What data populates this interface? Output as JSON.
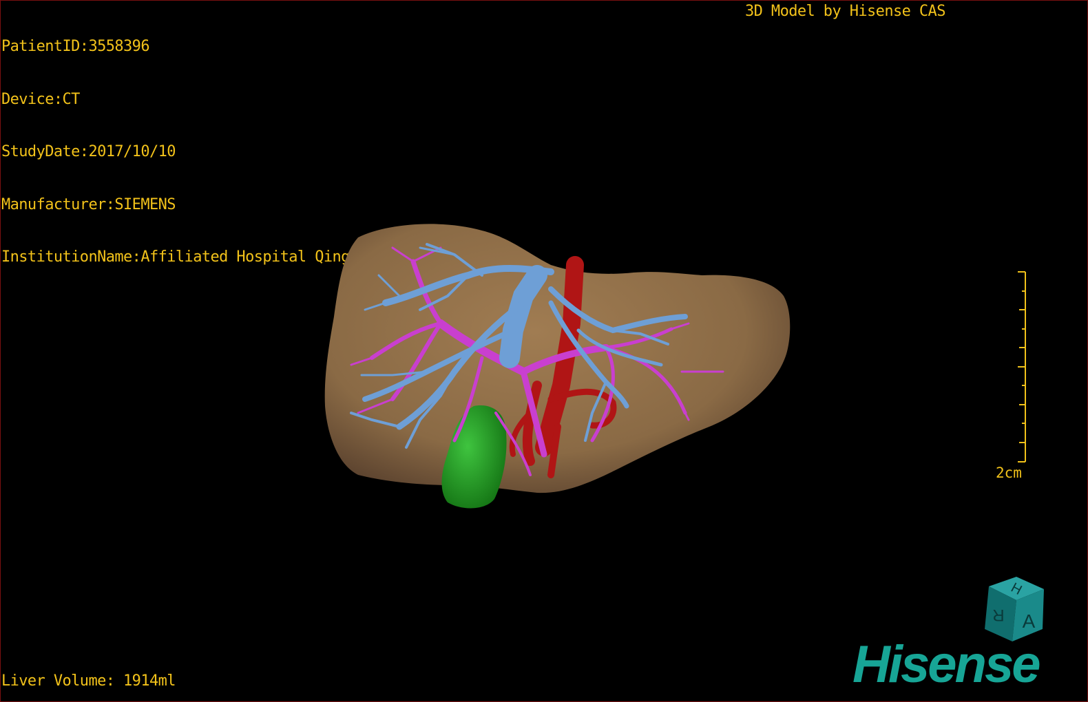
{
  "header": {
    "patient_id": "PatientID:3558396",
    "device": "Device:CT",
    "study_date": "StudyDate:2017/10/10",
    "manufacturer": "Manufacturer:SIEMENS",
    "institution": "InstitutionName:Affiliated Hospital Qingdao University-C"
  },
  "model_title": "3D Model by Hisense CAS",
  "footer": {
    "liver_volume": "Liver Volume: 1914ml"
  },
  "scale": {
    "label": "2cm"
  },
  "orientation_cube": {
    "face_front": "A",
    "face_top": "H",
    "face_side": "R"
  },
  "brand": {
    "logo_text": "Hisense"
  },
  "colors": {
    "overlay_text": "#f2c21a",
    "liver": "#8a6a45",
    "hepatic_vein": "#6e9fd6",
    "portal_vein": "#c93fcf",
    "artery_ivc": "#b01515",
    "gallbladder": "#1e9a1e",
    "brand": "#17a596",
    "cube": "#1a8a8a"
  }
}
